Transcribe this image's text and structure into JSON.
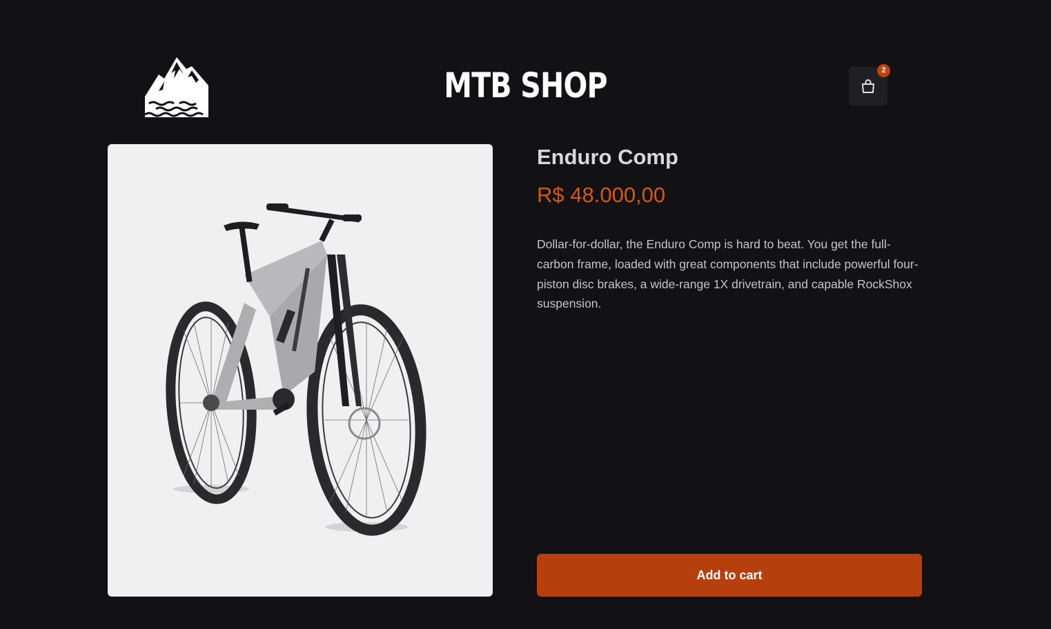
{
  "header": {
    "shop_title": "MTB SHOP",
    "logo_icon": "mountain-logo-icon",
    "cart": {
      "icon": "shopping-bag-icon",
      "badge_count": "2"
    }
  },
  "product": {
    "name": "Enduro Comp",
    "price": "R$ 48.000,00",
    "description": "Dollar-for-dollar, the Enduro Comp is hard to beat. You get the full-carbon frame, loaded with great components that include powerful four-piston disc brakes, a wide-range 1X drivetrain, and capable RockShox suspension.",
    "image_icon": "mountain-bike-image",
    "add_to_cart_label": "Add to cart"
  },
  "colors": {
    "background": "#121214",
    "accent": "#b63f0e",
    "price": "#d9580f",
    "badge": "#c2410c",
    "image_background": "#f1f0f1"
  }
}
